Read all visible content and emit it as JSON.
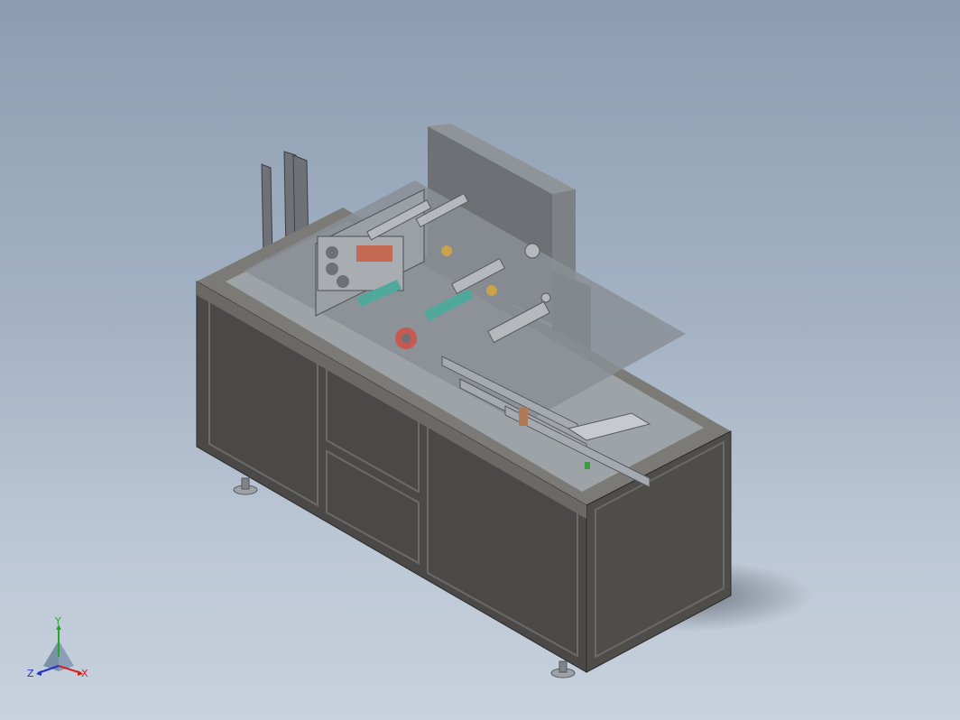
{
  "viewport": {
    "background_top": "#8d9db1",
    "background_bottom": "#c8d1dd"
  },
  "model": {
    "cabinet_color": "#4a4947",
    "cabinet_edge_color": "#77756f",
    "mechanism_color": "#8a8f96",
    "accent_green": "#4fa89a",
    "accent_red": "#c45a52",
    "accent_gold": "#c9a24a"
  },
  "triad": {
    "x_label": "X",
    "y_label": "Y",
    "z_label": "Z",
    "x_color": "#cc2222",
    "y_color": "#22aa22",
    "z_color": "#2233cc"
  }
}
